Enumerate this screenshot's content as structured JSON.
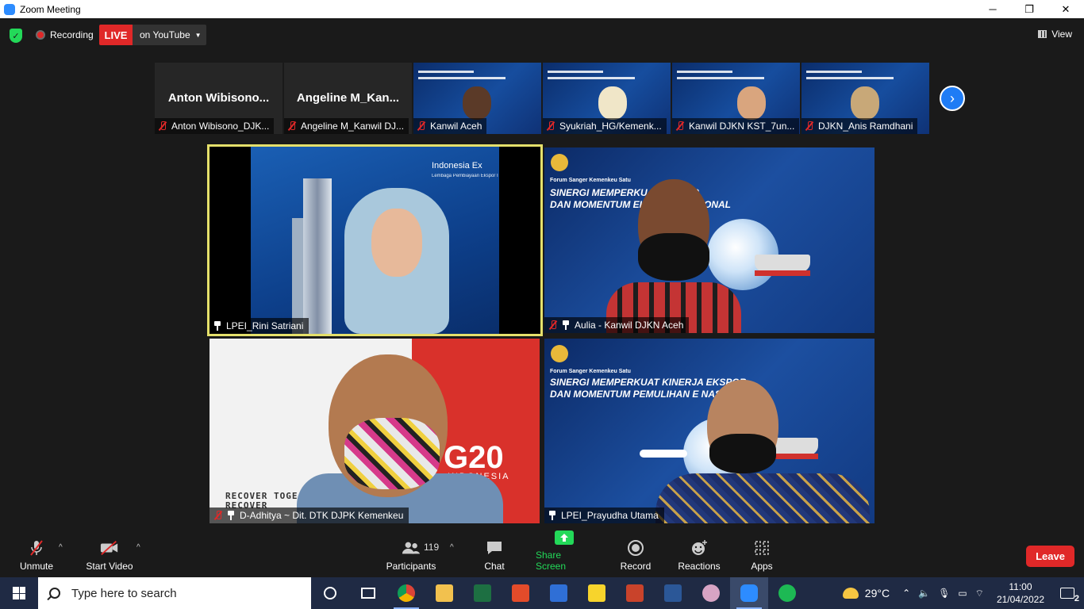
{
  "window": {
    "title": "Zoom Meeting",
    "minimize": "─",
    "maximize": "❐",
    "close": "✕"
  },
  "topbar": {
    "recording_label": "Recording",
    "live_label": "LIVE",
    "stream_label": "on YouTube",
    "view_label": "View"
  },
  "thumbnails": [
    {
      "display_name": "Anton  Wibisono...",
      "tag": "Anton Wibisono_DJK..."
    },
    {
      "display_name": "Angeline  M_Kan...",
      "tag": "Angeline M_Kanwil DJ..."
    },
    {
      "tag": "Kanwil Aceh"
    },
    {
      "tag": "Syukriah_HG/Kemenk..."
    },
    {
      "tag": "Kanwil DJKN KST_7un..."
    },
    {
      "tag": "DJKN_Anis Ramdhani"
    }
  ],
  "main_tiles": {
    "tile1": {
      "tag": "LPEI_Rini Satriani",
      "brand": "Indonesia Ex",
      "brand_sub": "Lembaga Pembiayaan Ekspor I"
    },
    "tile2": {
      "tag": "Aulia - Kanwil DJKN Aceh",
      "forum": "Forum Sanger Kemenkeu Satu",
      "line1": "SINERGI MEMPERKU        A EKSPOR",
      "line2": "DAN MOMENTUM        EKONOMI NASIONAL"
    },
    "tile3": {
      "tag": "D-Adhitya ~ Dit. DTK DJPK Kemenkeu",
      "g20": "G20",
      "g20_sub": "INDONESIA",
      "recover1": "RECOVER TOGE",
      "recover2": "RECOVER"
    },
    "tile4": {
      "tag": "LPEI_Prayudha Utama",
      "forum": "Forum Sanger Kemenkeu Satu",
      "line1": "SINERGI MEMPERKUAT KINERJA EKSPOR",
      "line2": "DAN MOMENTUM PEMULIHAN E     NASIONAL"
    }
  },
  "controls": {
    "unmute": "Unmute",
    "start_video": "Start Video",
    "participants": "Participants",
    "participants_count": "119",
    "chat": "Chat",
    "share_screen": "Share Screen",
    "record": "Record",
    "reactions": "Reactions",
    "apps": "Apps",
    "leave": "Leave"
  },
  "taskbar": {
    "search_placeholder": "Type here to search",
    "temperature": "29°C",
    "time": "11:00",
    "date": "21/04/2022",
    "notification_count": "2"
  },
  "colors": {
    "accent_blue": "#1f7cf5",
    "live_red": "#e02828",
    "share_green": "#23d959",
    "active_speaker_border": "#e5e06b"
  }
}
